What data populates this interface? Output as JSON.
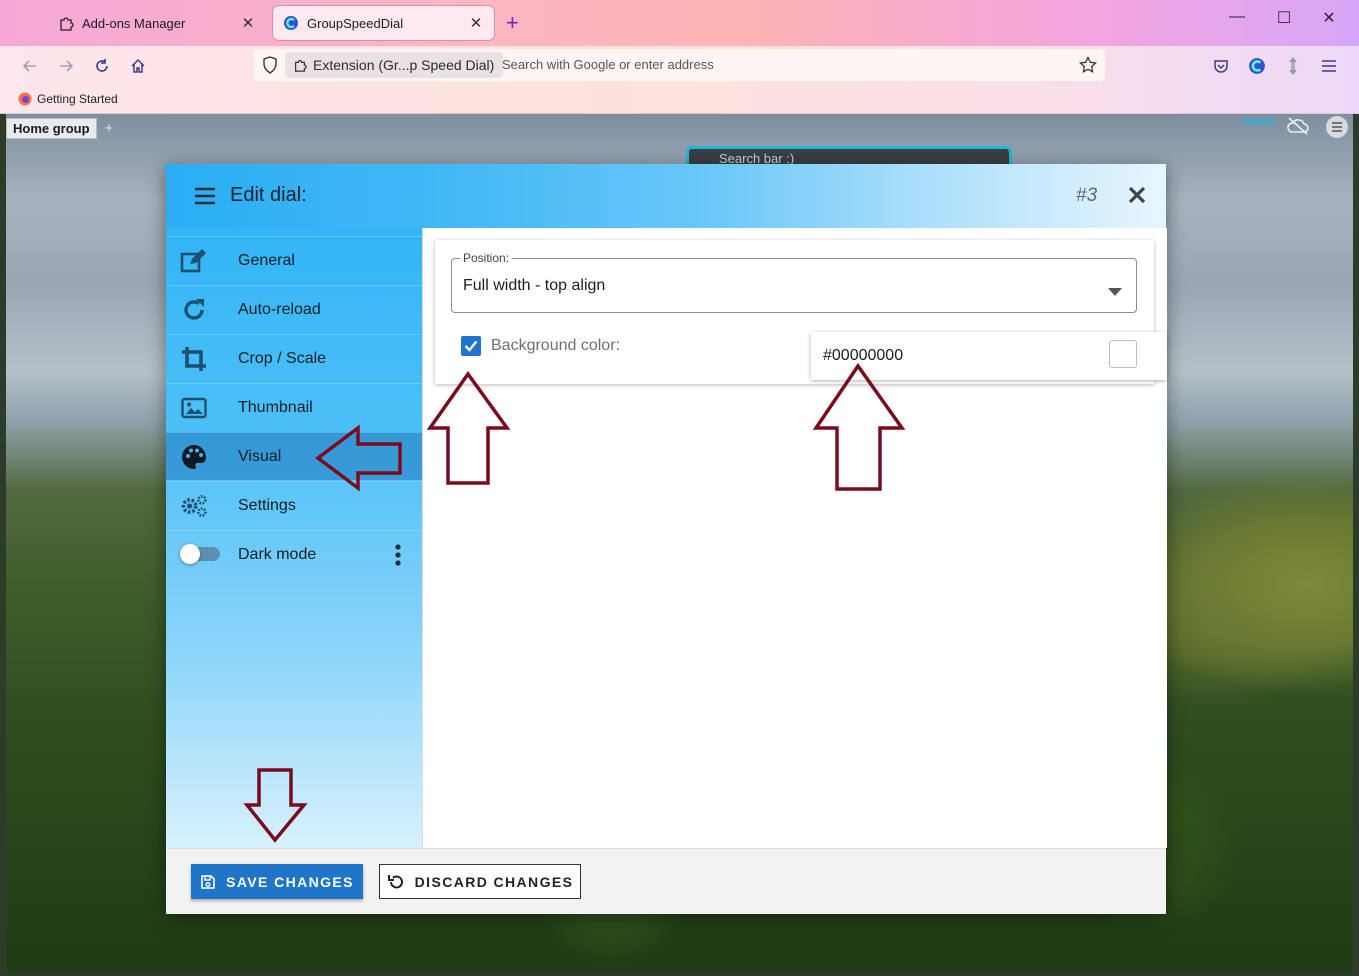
{
  "browser": {
    "tabs": [
      {
        "label": "Add-ons Manager",
        "icon": "puzzle-icon",
        "active": false
      },
      {
        "label": "GroupSpeedDial",
        "icon": "groupspeeddial-icon",
        "active": true
      }
    ],
    "url_identity": "Extension (Gr...p Speed Dial)",
    "url_placeholder": "Search with Google or enter address",
    "bookmark": "Getting Started"
  },
  "speeddial": {
    "group_tab": "Home group",
    "home_link": "Home",
    "search_placeholder": "Search bar :)"
  },
  "dialog": {
    "title": "Edit dial:",
    "number": "#3",
    "sidebar": {
      "items": [
        {
          "label": "General",
          "icon": "edit-icon"
        },
        {
          "label": "Auto-reload",
          "icon": "reload-icon"
        },
        {
          "label": "Crop / Scale",
          "icon": "crop-icon"
        },
        {
          "label": "Thumbnail",
          "icon": "image-icon"
        },
        {
          "label": "Visual",
          "icon": "palette-icon",
          "active": true
        },
        {
          "label": "Settings",
          "icon": "gears-icon"
        },
        {
          "label": "Dark mode",
          "icon": "toggle-icon",
          "enabled": false
        }
      ]
    },
    "visual": {
      "position_label": "Position:",
      "position_value": "Full width - top align",
      "background_color_label": "Background color:",
      "background_color_checked": true,
      "background_color_value": "#00000000"
    },
    "footer": {
      "save_label": "SAVE CHANGES",
      "discard_label": "DISCARD CHANGES"
    }
  },
  "colors": {
    "accent": "#1f76c9",
    "header_gradient_start": "#2aaef4",
    "annotation_arrow": "#7a0a1c"
  }
}
